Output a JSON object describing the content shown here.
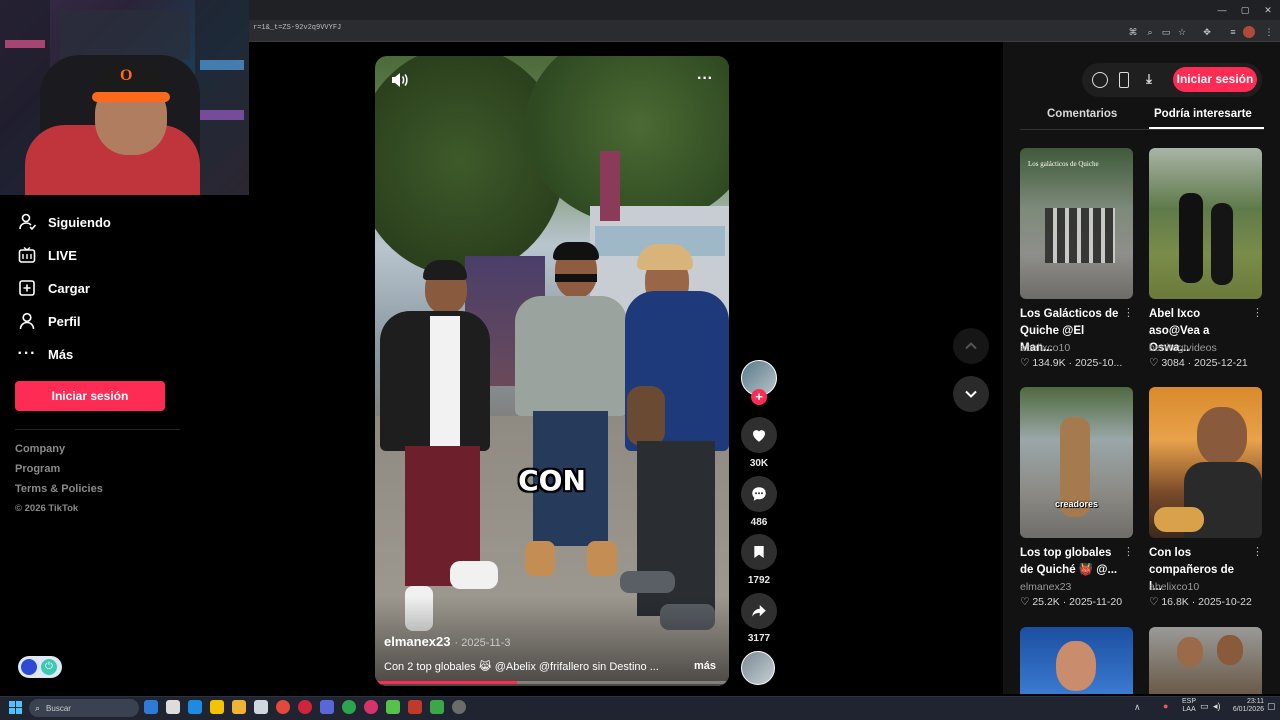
{
  "browser": {
    "url": "r=1&_t=ZS-92v2q9VVYFJ",
    "window_controls": [
      "—",
      "▢",
      "✕"
    ]
  },
  "nav": {
    "items": [
      {
        "label": "Siguiendo",
        "icon": "following-icon"
      },
      {
        "label": "LIVE",
        "icon": "live-icon"
      },
      {
        "label": "Cargar",
        "icon": "upload-icon"
      },
      {
        "label": "Perfil",
        "icon": "profile-icon"
      },
      {
        "label": "Más",
        "icon": "more-icon"
      }
    ],
    "login_label": "Iniciar sesión",
    "footer": [
      "Company",
      "Program",
      "Terms & Policies"
    ],
    "copyright": "© 2026 TikTok"
  },
  "video": {
    "caption_overlay": "CON",
    "author": "elmanex23",
    "date": "· 2025-11-3",
    "description": "Con 2 top globales 😹 @Abelix @frifallero sin Destino ...",
    "more_label": "más",
    "progress": 0.4
  },
  "actions": {
    "likes": "30K",
    "comments": "486",
    "saves": "1792",
    "shares": "3177"
  },
  "header_right": {
    "login_label": "Iniciar sesión"
  },
  "tabs": {
    "comments": "Comentarios",
    "suggested": "Podría interesarte",
    "active": "suggested"
  },
  "suggestions": [
    {
      "title_line1": "Los Galácticos de",
      "title_line2": "Quiche @El Man...",
      "user": "abelixco10",
      "likes": "134.9K",
      "date": "2025-10...",
      "overlay": "Los galácticos de Quiche"
    },
    {
      "title_line1": "Abel Ixco",
      "title_line2": "aso@Vea a Oswa...",
      "user": "benitogtvideos",
      "likes": "3084",
      "date": "2025-12-21",
      "overlay": ""
    },
    {
      "title_line1": "Los top globales",
      "title_line2": "de Quiché 👹 @...",
      "user": "elmanex23",
      "likes": "25.2K",
      "date": "2025-11-20",
      "overlay": "creadores"
    },
    {
      "title_line1": "Con los",
      "title_line2": "compañeros de l...",
      "user": "abelixco10",
      "likes": "16.8K",
      "date": "2025-10-22",
      "overlay": ""
    }
  ],
  "taskbar": {
    "search_placeholder": "Buscar",
    "lang_line1": "ESP",
    "lang_line2": "LAA",
    "time": "23:11",
    "date": "6/01/2026"
  },
  "colors": {
    "accent": "#fe2c55",
    "panel": "#121212",
    "rail_button": "#2f2f2f"
  }
}
